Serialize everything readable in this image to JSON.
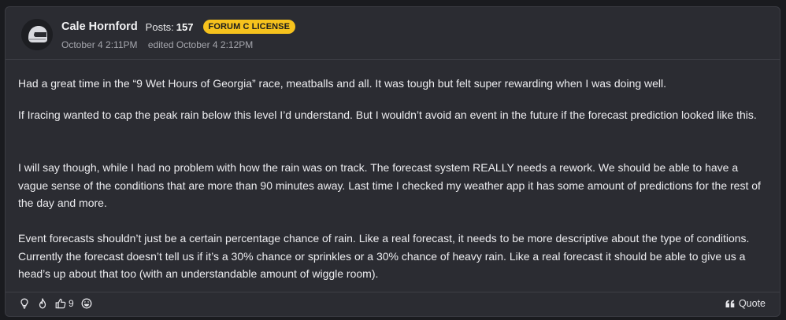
{
  "post": {
    "author": "Cale Hornford",
    "posts_label": "Posts:",
    "posts_count": "157",
    "license_badge": "FORUM C LICENSE",
    "date": "October 4 2:11PM",
    "edited": "edited October 4 2:12PM",
    "paragraphs": [
      "Had a great time in the “9 Wet Hours of Georgia” race, meatballs and all. It was tough but felt super rewarding when I was doing well.",
      "If Iracing wanted to cap the peak rain below this level I’d understand. But I wouldn’t avoid an event in the future if the forecast prediction looked like this.",
      "I will say though, while I had no problem with how the rain was on track. The forecast system REALLY needs a rework. We should be able to have a vague sense of the conditions that are more than 90 minutes away. Last time I checked my weather app it has some amount of predictions for the rest of the day and more.",
      "Event forecasts shouldn’t just be a certain percentage chance of rain. Like a real forecast, it needs to be more descriptive about the type of conditions. Currently the forecast doesn’t tell us if it’s a 30% chance or sprinkles or a 30% chance of heavy rain. Like a real forecast it should be able to give us a head’s up about that too (with an understandable amount of wiggle room)."
    ]
  },
  "footer": {
    "like_count": "9",
    "quote_label": "Quote"
  },
  "icons": {
    "avatar": "helmet-avatar",
    "insightful": "lightbulb-icon",
    "fire": "flame-icon",
    "like": "thumbs-up-icon",
    "funny": "laugh-icon",
    "quote": "quote-icon"
  },
  "colors": {
    "card_bg": "#2b2c32",
    "page_bg": "#1a1b1f",
    "badge_bg": "#f6c21d",
    "text": "#ececef",
    "meta_text": "#a5a6ad"
  }
}
